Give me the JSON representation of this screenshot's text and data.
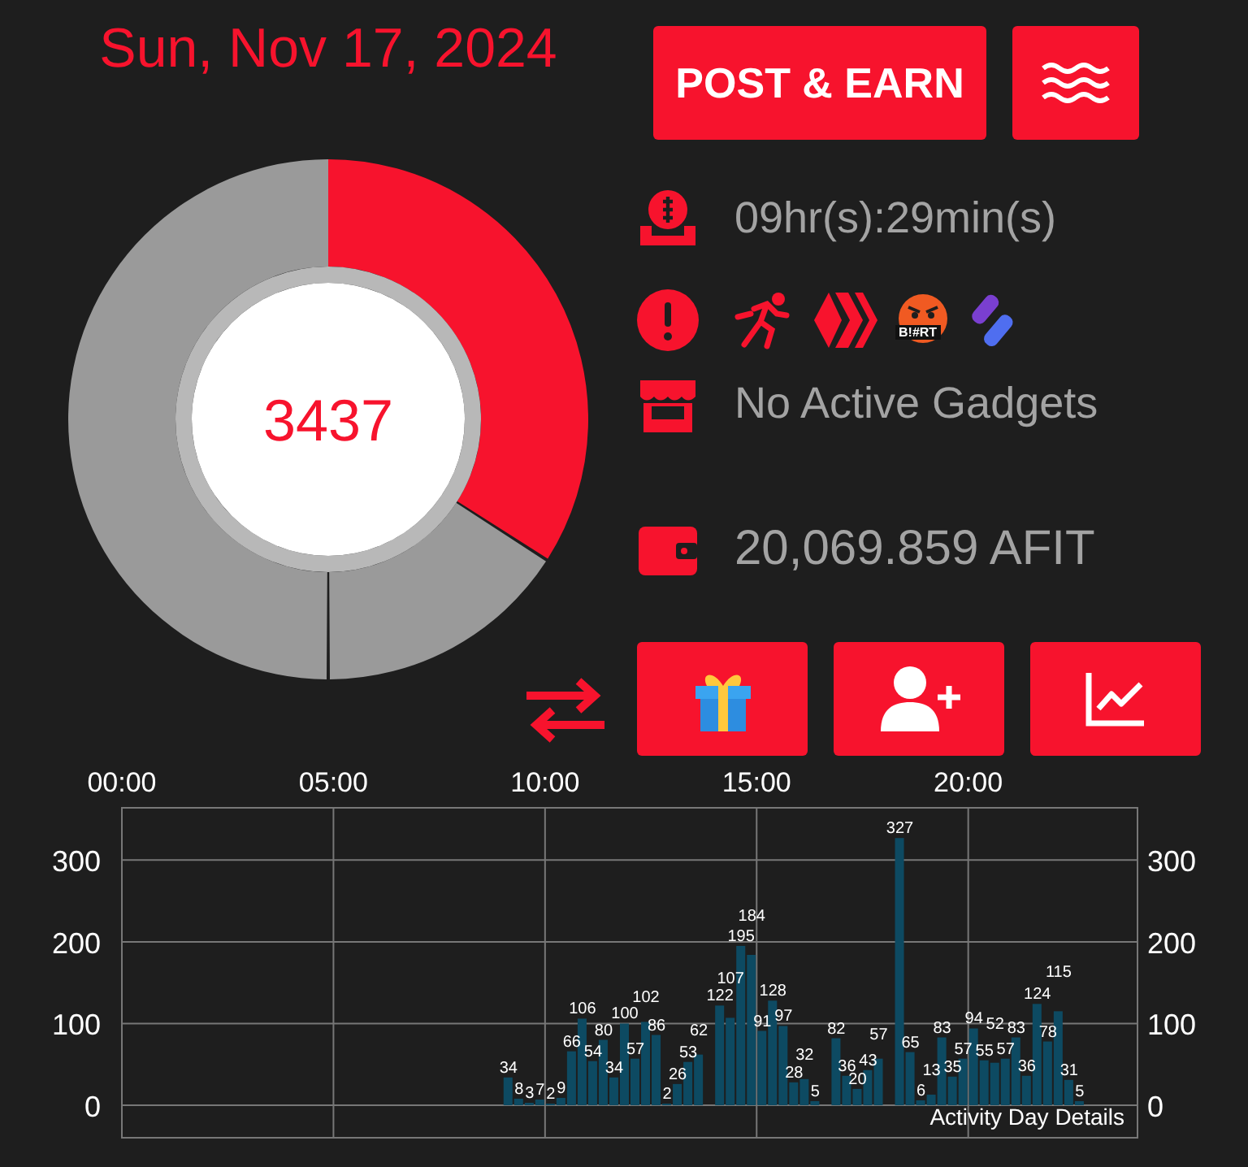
{
  "date": "Sun, Nov 17, 2024",
  "ring": {
    "value": "3437"
  },
  "post_button": "POST & EARN",
  "info_rows": [
    {
      "kind": "timer",
      "text": "09hr(s):29min(s)"
    },
    {
      "kind": "alerts",
      "badges": [
        {
          "kind": "runner"
        },
        {
          "kind": "hive"
        },
        {
          "kind": "face",
          "text": "B!#RT"
        },
        {
          "kind": "stripe"
        }
      ]
    },
    {
      "kind": "shop",
      "text": "No Active Gadgets"
    },
    {
      "kind": "wallet",
      "text": "20,069.859 AFIT"
    }
  ],
  "actions": [
    {
      "kind": "gift"
    },
    {
      "kind": "add_user"
    },
    {
      "kind": "chart"
    }
  ],
  "activity": {
    "caption": "Activity Day Details",
    "right_axis_labels": [
      "300",
      "200",
      "100",
      "0"
    ],
    "chart_data": {
      "type": "bar",
      "grid": true,
      "xlim": [
        0,
        24
      ],
      "ylim": [
        0,
        364
      ],
      "xticks": [
        {
          "value": 0,
          "label": "00:00"
        },
        {
          "value": 5,
          "label": "05:00"
        },
        {
          "value": 10,
          "label": "10:00"
        },
        {
          "value": 15,
          "label": "15:00"
        },
        {
          "value": 20,
          "label": "20:00"
        }
      ],
      "yticks": [
        {
          "value": 300,
          "label": "300"
        },
        {
          "value": 200,
          "label": "200"
        },
        {
          "value": 100,
          "label": "100"
        },
        {
          "value": 0,
          "label": "0"
        }
      ],
      "data_labels": true,
      "x": [
        9,
        9.25,
        9.5,
        9.75,
        10,
        10.25,
        10.5,
        10.75,
        11,
        11.25,
        11.5,
        11.75,
        12,
        12.25,
        12.5,
        12.75,
        13,
        13.25,
        13.5,
        14,
        14.25,
        14.5,
        14.75,
        15,
        15.25,
        15.5,
        15.75,
        16,
        16.25,
        16.75,
        17,
        17.25,
        17.5,
        17.75,
        18.25,
        18.5,
        18.75,
        19,
        19.25,
        19.5,
        19.75,
        20,
        20.25,
        20.5,
        20.75,
        21,
        21.25,
        21.5,
        21.75,
        22,
        22.25,
        22.5
      ],
      "values": [
        34,
        8,
        3,
        7,
        2,
        9,
        66,
        106,
        54,
        80,
        34,
        100,
        57,
        102,
        86,
        2,
        26,
        53,
        62,
        122,
        107,
        195,
        184,
        91,
        128,
        97,
        28,
        32,
        5,
        82,
        36,
        20,
        43,
        57,
        327,
        65,
        6,
        13,
        83,
        35,
        57,
        94,
        55,
        52,
        57,
        83,
        36,
        124,
        78,
        115,
        31,
        5
      ]
    }
  }
}
